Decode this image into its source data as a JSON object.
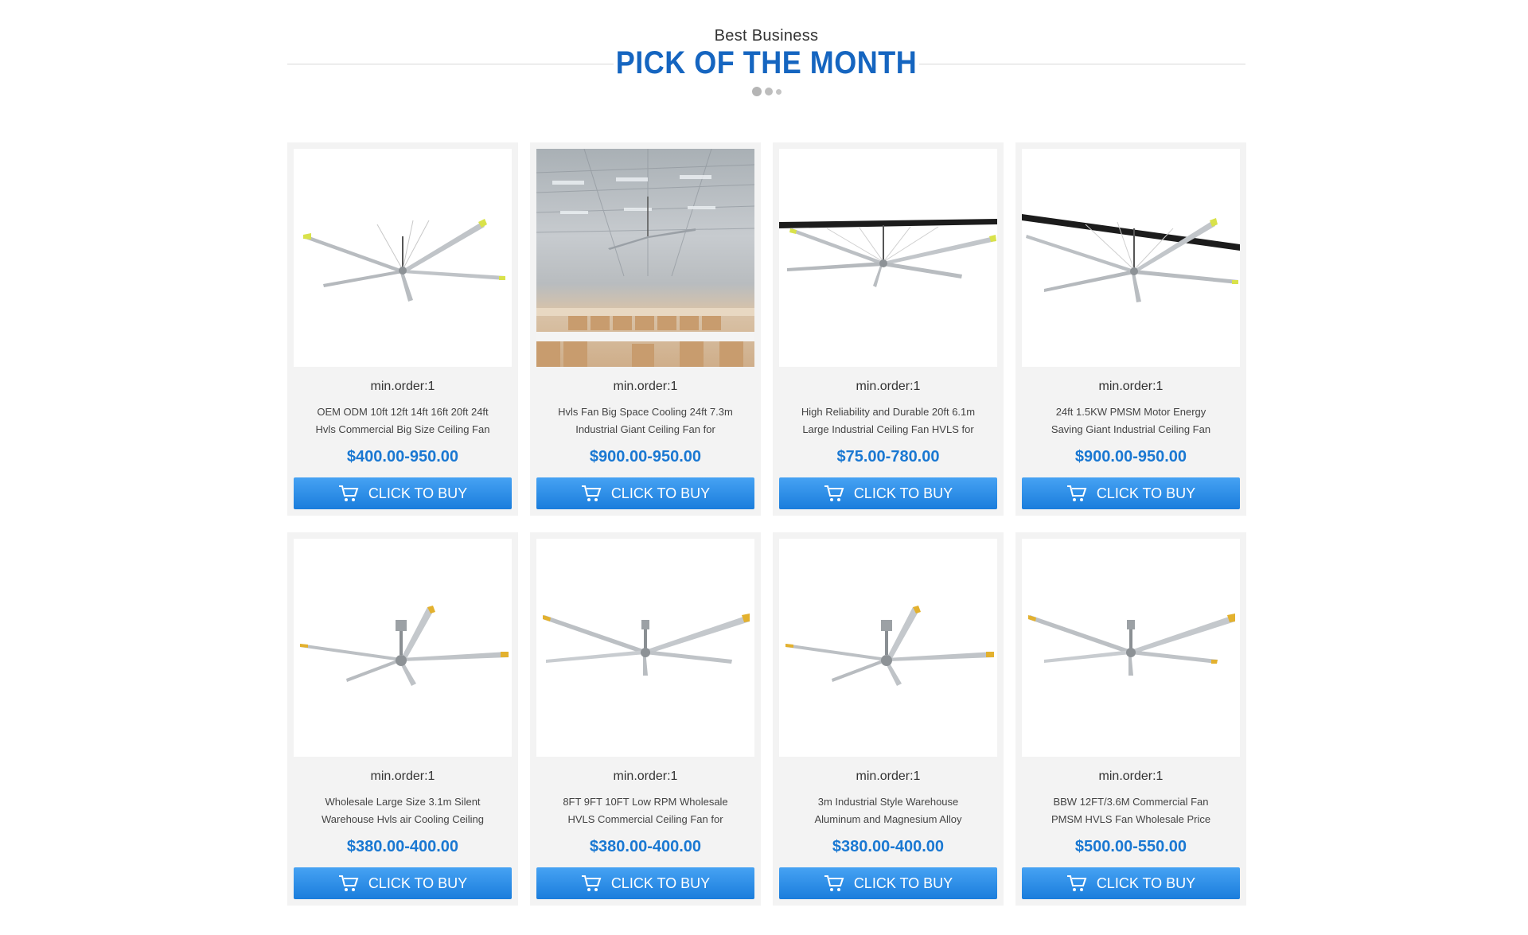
{
  "header": {
    "subtitle": "Best Business",
    "title": "PICK OF THE MONTH"
  },
  "colors": {
    "accent": "#1565c0",
    "price": "#1a78d2",
    "button_top": "#46a2f3",
    "button_bottom": "#1a7ddc",
    "card_bg": "#f3f3f3"
  },
  "buy_icon": "cart-icon",
  "products": [
    {
      "order": "min.order:1",
      "name": "OEM ODM 10ft 12ft 14ft 16ft 20ft 24ft Hvls Commercial Big Size Ceiling Fan",
      "price": "$400.00-950.00",
      "button": "CLICK TO BUY"
    },
    {
      "order": "min.order:1",
      "name": "Hvls Fan Big Space Cooling 24ft 7.3m Industrial Giant Ceiling Fan for",
      "price": "$900.00-950.00",
      "button": "CLICK TO BUY"
    },
    {
      "order": "min.order:1",
      "name": "High Reliability and Durable 20ft 6.1m Large Industrial Ceiling Fan HVLS for",
      "price": "$75.00-780.00",
      "button": "CLICK TO BUY"
    },
    {
      "order": "min.order:1",
      "name": "24ft 1.5KW PMSM Motor Energy Saving Giant Industrial Ceiling Fan",
      "price": "$900.00-950.00",
      "button": "CLICK TO BUY"
    },
    {
      "order": "min.order:1",
      "name": "Wholesale Large Size 3.1m Silent Warehouse Hvls air Cooling Ceiling",
      "price": "$380.00-400.00",
      "button": "CLICK TO BUY"
    },
    {
      "order": "min.order:1",
      "name": "8FT 9FT 10FT Low RPM Wholesale HVLS Commercial Ceiling Fan for",
      "price": "$380.00-400.00",
      "button": "CLICK TO BUY"
    },
    {
      "order": "min.order:1",
      "name": "3m Industrial Style Warehouse Aluminum and Magnesium Alloy",
      "price": "$380.00-400.00",
      "button": "CLICK TO BUY"
    },
    {
      "order": "min.order:1",
      "name": "BBW 12FT/3.6M Commercial Fan PMSM HVLS Fan Wholesale Price",
      "price": "$500.00-550.00",
      "button": "CLICK TO BUY"
    }
  ]
}
